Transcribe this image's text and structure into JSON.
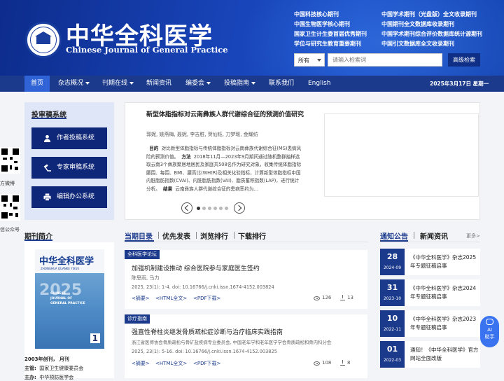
{
  "header": {
    "title_cn": "中华全科医学",
    "title_en": "Chinese Journal of General Practice",
    "badges_left": [
      "中国科技核心期刊",
      "中国生物医学核心期刊",
      "国家卫生计生委首届优秀期刊",
      "学位与研究生教育重要期刊"
    ],
    "badges_right": [
      "中国学术期刊（光盘版）全文收录期刊",
      "中国期刊全文数据库收录期刊",
      "中国学术期刊综合评价数据库统计源期刊",
      "中国引文数据库全文收录期刊"
    ]
  },
  "search": {
    "scope": "所有",
    "placeholder": "请输入检索词",
    "advanced_label": "高级检索"
  },
  "nav": {
    "items": [
      {
        "label": "首页"
      },
      {
        "label": "杂志概况"
      },
      {
        "label": "刊期在线"
      },
      {
        "label": "新闻资讯"
      },
      {
        "label": "编委会"
      },
      {
        "label": "投稿指南"
      },
      {
        "label": "联系我们"
      },
      {
        "label": "English"
      }
    ],
    "date": "2025年3月17日 星期一"
  },
  "side_qr": {
    "weibo_label": "方微博",
    "wechat_label": "信公众号"
  },
  "submission": {
    "title": "投审稿系统",
    "buttons": [
      "作者投稿系统",
      "专家审稿系统",
      "编辑办公系统"
    ]
  },
  "featured": {
    "title": "新型体脂指标对云南彝族人群代谢综合征的预测价值研究",
    "authors": "郭妮, 姚燕梅, 聂妮, 李吉胜, 贺仙钰, 刀梦瑶, 金耀纺",
    "objective_label": "目的",
    "objective_text": "对比新型体脂指标与传统体脂指标对云南彝族代谢综合征(MS)患病风险的预测价值。",
    "method_label": "方法",
    "method_text": "2018年11月—2023年9月期间通过随机整群抽样选取云南3个彝族聚居地居民及家庭共508名作为研究对象，收集传统体脂指标腰围、每围、BMI、腰高比(WHtR)及相关化验指标，计算新型体脂指标中国内脏脂肪指数(CVAI)、内脏脂肪指数(VAI)、脂质蓄积指数(LAP)，进行统计分析。",
    "result_label": "结果",
    "result_text": "云南彝族人群代谢综合征的患病率约为…",
    "slides": 6,
    "active_slide": 1
  },
  "intro": {
    "title": "期刊简介",
    "cover": {
      "title": "中华全科医学",
      "subtitle": "ZHONGHUA QUANKE YIXUE",
      "en_lines": [
        "CHINESE",
        "JOURNAL OF",
        "GENERAL PRACTICE"
      ],
      "issue": "1",
      "bigtext": "2025"
    },
    "founded": "2003年创刊，  月刊",
    "sponsor_label": "主管:",
    "sponsor": "国家卫生健康委员会",
    "host_label": "主办:",
    "host": "中华预防医学会"
  },
  "tabs": [
    {
      "label": "当期目录"
    },
    {
      "label": "优先发表"
    },
    {
      "label": "浏览排行"
    },
    {
      "label": "下载排行"
    }
  ],
  "articles": [
    {
      "category": "全科医学论坛",
      "title": "加强机制建设推动 综合医院参与家庭医生签约",
      "authors": "陈思雨, 马力",
      "meta": "2025, 23(1): 1-4.   doi: 10.16766/j.cnki.issn.1674-4152.003824",
      "links": [
        "<摘要>",
        "<HTML全文>",
        "<PDF下载>"
      ],
      "views": "126",
      "downloads": "13"
    },
    {
      "category": "诊疗指南",
      "title": "强直性脊柱炎继发骨质疏松症诊断与治疗临床实践指南",
      "authors": "浙江省医师协会骨质疏松与骨矿盐疾病专业委员会, 中国老年学和老年医学学会骨质疏松和骨内科分会",
      "meta": "2025, 23(1): 5-16.   doi: 10.16766/j.cnki.issn.1674-4152.003825",
      "links": [
        "<摘要>",
        "<HTML全文>",
        "<PDF下载>"
      ],
      "views": "108",
      "downloads": "8"
    }
  ],
  "notices": {
    "tab_active": "通知公告",
    "tab_other": "新闻资讯",
    "more": "更多>",
    "items": [
      {
        "day": "28",
        "month": "2024-09",
        "text": "《中华全科医学》杂志2025年专题征稿启事"
      },
      {
        "day": "31",
        "month": "2023-10",
        "text": "《中华全科医学》杂志2024年专题征稿启事"
      },
      {
        "day": "10",
        "month": "2022-11",
        "text": "《中华全科医学》杂志2023年专题征稿启事"
      },
      {
        "day": "01",
        "month": "2022-03",
        "text": "通知！《中华全科医学》官方网站全面改版"
      }
    ]
  },
  "ai_helper": {
    "label_1": "AI",
    "label_2": "助手"
  },
  "colors": {
    "brand": "#1b3a8c",
    "nav_active": "#2f63d6",
    "header_start": "#0d2c8c",
    "ai": "#3a73f0"
  }
}
